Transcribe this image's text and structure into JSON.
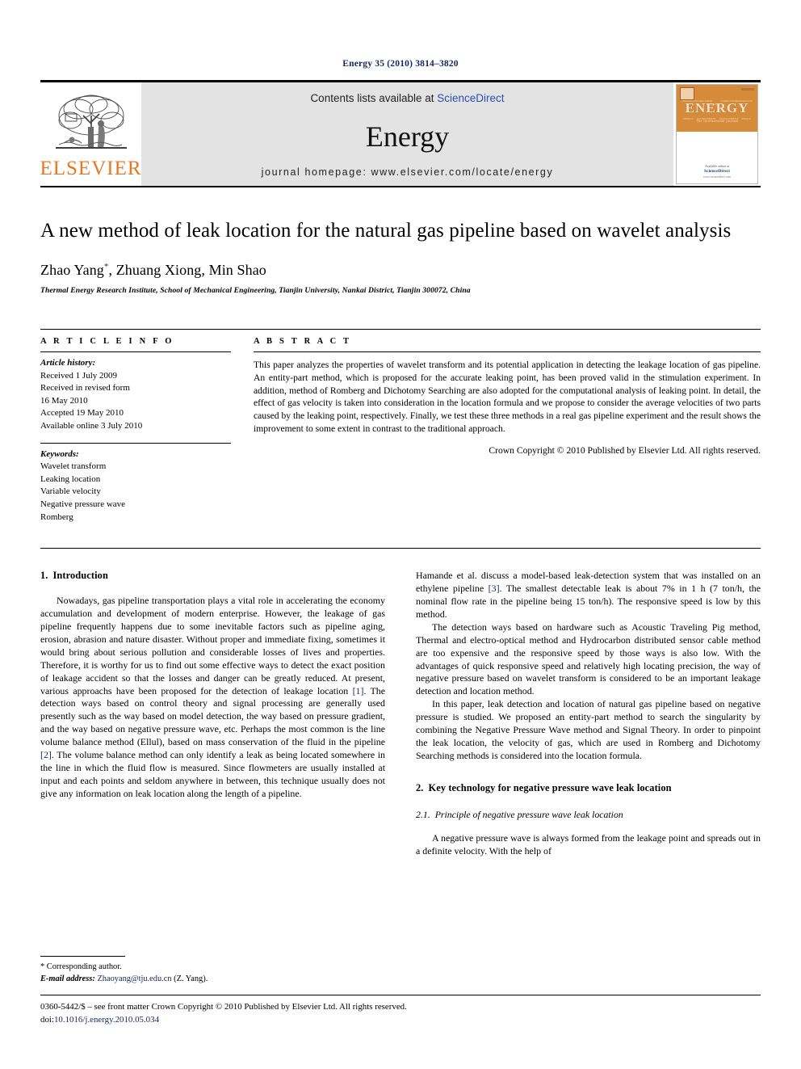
{
  "running_head": "Energy 35 (2010) 3814–3820",
  "masthead": {
    "contents_prefix": "Contents lists available at ",
    "sciencedirect": "ScienceDirect",
    "journal_title": "Energy",
    "homepage": "journal homepage: www.elsevier.com/locate/energy",
    "publisher_wordmark": "ELSEVIER",
    "cover": {
      "title": "ENERGY",
      "subtitle": "The international journal",
      "available_at": "Available online at",
      "sciencedirect": "ScienceDirect",
      "url": "www.sciencedirect.com",
      "top_ticks": [
        "THERMODYNAMICS",
        "HEAT TRANSFER",
        "COMBUSTION",
        "MODELLING"
      ],
      "bottom_ticks": [
        "ENERGY",
        "ENVIRONMENT",
        "MANAGEMENT",
        "POLICY"
      ]
    }
  },
  "article": {
    "title": "A new method of leak location for the natural gas pipeline based on wavelet analysis",
    "authors": "Zhao Yang, Zhuang Xiong, Min Shao",
    "corresponding_marker": "*",
    "affiliation": "Thermal Energy Research Institute, School of Mechanical Engineering, Tianjin University, Nankai District, Tianjin 300072, China"
  },
  "article_info": {
    "heading": "A R T I C L E   I N F O",
    "history_label": "Article history:",
    "history": [
      "Received 1 July 2009",
      "Received in revised form",
      "16 May 2010",
      "Accepted 19 May 2010",
      "Available online 3 July 2010"
    ],
    "keywords_label": "Keywords:",
    "keywords": [
      "Wavelet transform",
      "Leaking location",
      "Variable velocity",
      "Negative pressure wave",
      "Romberg"
    ]
  },
  "abstract": {
    "heading": "A B S T R A C T",
    "text": "This paper analyzes the properties of wavelet transform and its potential application in detecting the leakage location of gas pipeline. An entity-part method, which is proposed for the accurate leaking point, has been proved valid in the stimulation experiment. In addition, method of Romberg and Dichotomy Searching are also adopted for the computational analysis of leaking point. In detail, the effect of gas velocity is taken into consideration in the location formula and we propose to consider the average velocities of two parts caused by the leaking point, respectively. Finally, we test these three methods in a real gas pipeline experiment and the result shows the improvement to some extent in contrast to the traditional approach.",
    "copyright": "Crown Copyright © 2010 Published by Elsevier Ltd. All rights reserved."
  },
  "sections": {
    "intro_num": "1.",
    "intro_title": "Introduction",
    "intro_p1": "Nowadays, gas pipeline transportation plays a vital role in accelerating the economy accumulation and development of modern enterprise. However, the leakage of gas pipeline frequently happens due to some inevitable factors such as pipeline aging, erosion, abrasion and nature disaster. Without proper and immediate fixing, sometimes it would bring about serious pollution and considerable losses of lives and properties. Therefore, it is worthy for us to find out some effective ways to detect the exact position of leakage accident so that the losses and danger can be greatly reduced. At present, various approachs have been proposed for the detection of leakage location ",
    "intro_p1_ref": "[1]",
    "intro_p1_cont": ". The detection ways based on control theory and signal processing are generally used presently such as the way based on model detection, the way based on pressure gradient, and the way based on negative pressure wave, etc. Perhaps the most common is the line volume balance method (Ellul), based on mass conservation of the fluid in the pipeline ",
    "intro_p1_ref2": "[2]",
    "intro_p1_cont2": ". The volume balance method can only identify a leak as being located somewhere in the line in which the fluid flow is measured. Since flowmeters are usually installed at input and each points and seldom anywhere in between, this technique usually does not give any information on leak location along the length of a pipeline.",
    "right_p1a": "Hamande et al. discuss a model-based leak-detection system that was installed on an ethylene pipeline ",
    "right_p1_ref": "[3]",
    "right_p1b": ". The smallest detectable leak is about 7% in 1 h (7 ton/h, the nominal flow rate in the pipeline being 15 ton/h). The responsive speed is low by this method.",
    "right_p2": "The detection ways based on hardware such as Acoustic Traveling Pig method, Thermal and electro-optical method and Hydrocarbon distributed sensor cable method are too expensive and the responsive speed by those ways is also low. With the advantages of quick responsive speed and relatively high locating precision, the way of negative pressure based on wavelet transform is considered to be an important leakage detection and location method.",
    "right_p3": "In this paper, leak detection and location of natural gas pipeline based on negative pressure is studied. We proposed an entity-part method to search the singularity by combining the Negative Pressure Wave method and Signal Theory. In order to pinpoint the leak location, the velocity of gas, which are used in Romberg and Dichotomy Searching methods is considered into the location formula.",
    "sec2_num": "2.",
    "sec2_title": "Key technology for negative pressure wave leak location",
    "sec21_num": "2.1.",
    "sec21_title": "Principle of negative pressure wave leak location",
    "sec21_p1": "A negative pressure wave is always formed from the leakage point and spreads out in a definite velocity. With the help of"
  },
  "footnote": {
    "corresponding": "* Corresponding author.",
    "email_label": "E-mail address:",
    "email": "Zhaoyang@tju.edu.cn",
    "email_suffix": "(Z. Yang)."
  },
  "page_footer": {
    "issn_line": "0360-5442/$ – see front matter Crown Copyright © 2010 Published by Elsevier Ltd. All rights reserved.",
    "doi_label": "doi:",
    "doi": "10.1016/j.energy.2010.05.034"
  },
  "colors": {
    "elsevier_orange": "#e87722",
    "link_blue": "#17255c",
    "sciencedirect_blue": "#2a4db5",
    "masthead_gray": "#e3e3e3"
  }
}
